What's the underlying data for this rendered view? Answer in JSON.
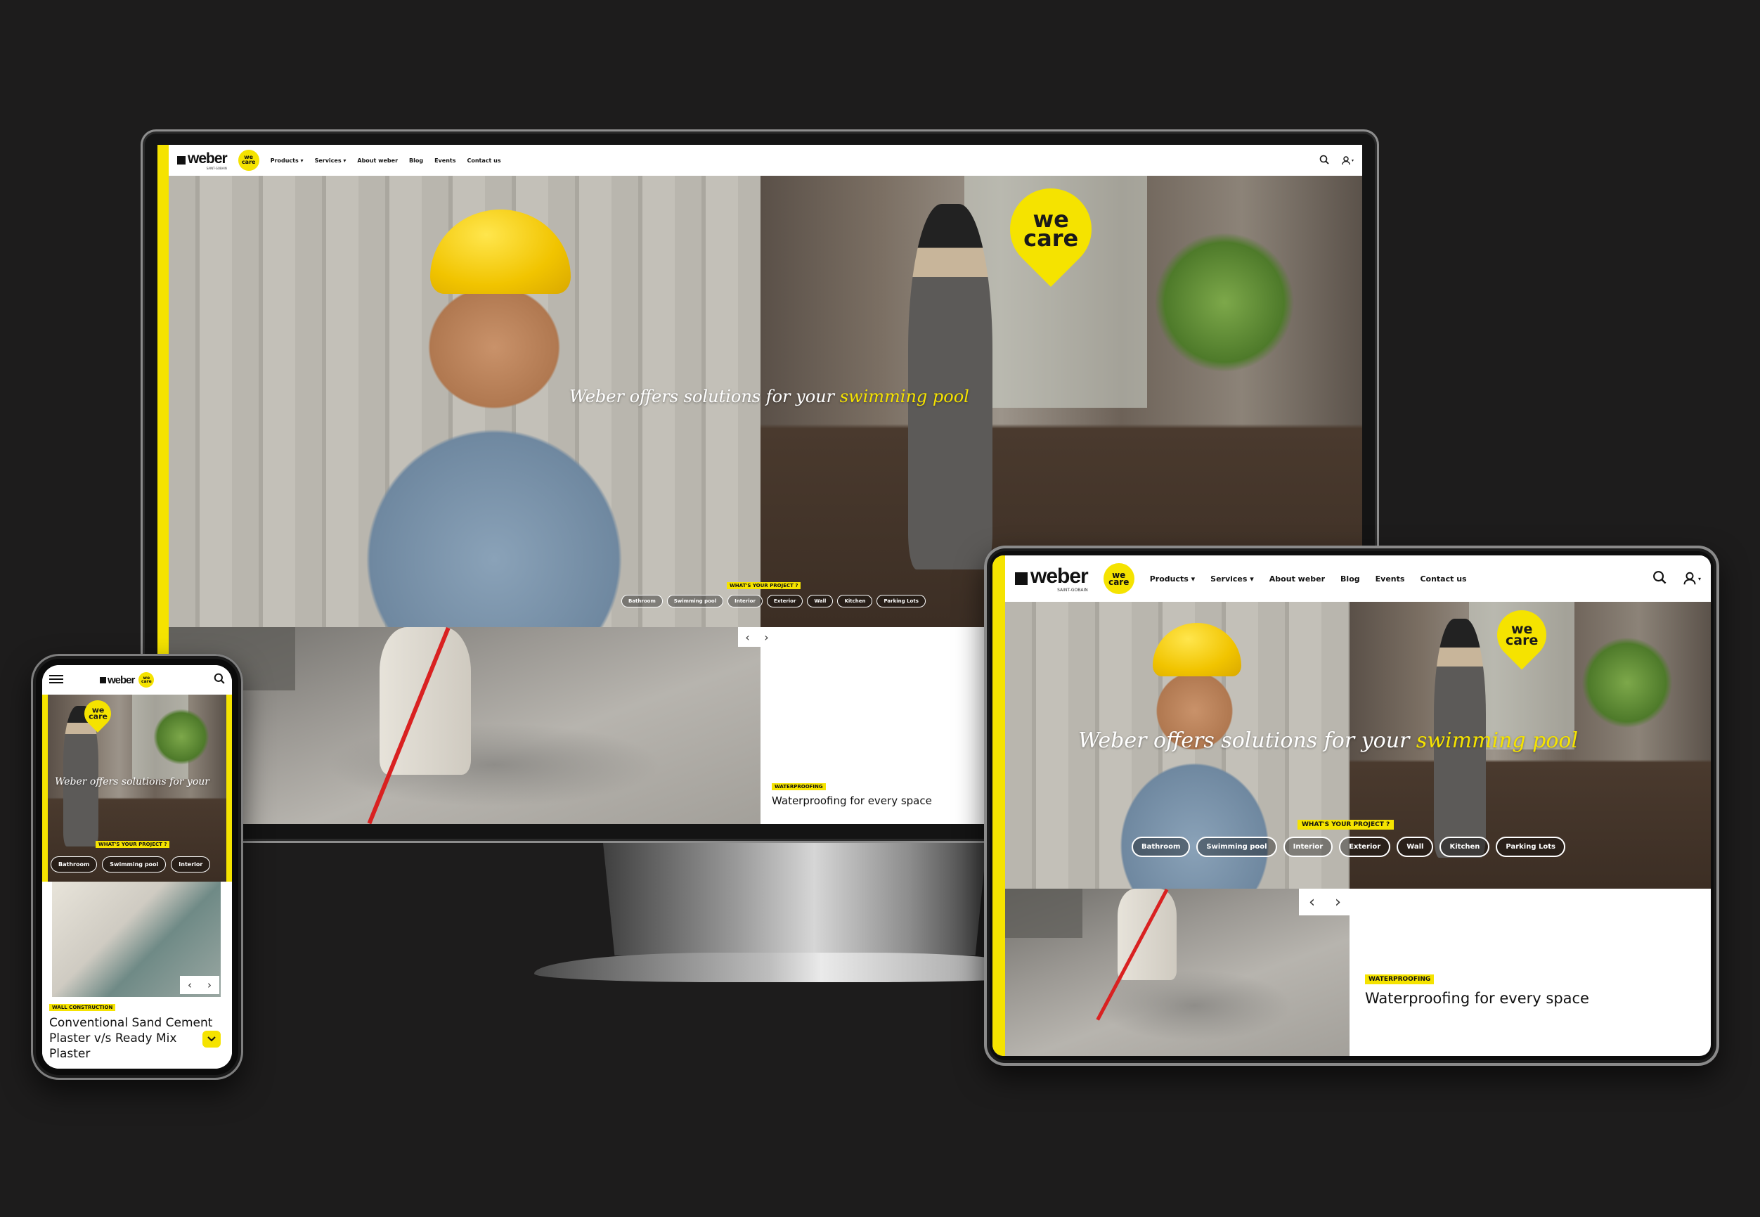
{
  "colors": {
    "background": "#1d1c1c",
    "brand_yellow": "#f5e300",
    "text": "#111111",
    "accent_red": "#d92121"
  },
  "brand": {
    "logo_text": "weber",
    "logo_sub": "SAINT-GOBAIN",
    "badge_line1": "we",
    "badge_line2": "care"
  },
  "nav": {
    "products": "Products ▾",
    "services": "Services ▾",
    "about": "About weber",
    "blog": "Blog",
    "events": "Events",
    "contact": "Contact us",
    "user_menu_caret": "▾"
  },
  "icons": {
    "search": "search-icon",
    "user": "user-icon",
    "menu": "hamburger-menu-icon",
    "prev": "chevron-left-icon",
    "next": "chevron-right-icon",
    "expand": "chevron-down-icon"
  },
  "hero": {
    "title_prefix": "Weber offers solutions for your ",
    "title_highlight": "swimming pool",
    "mobile_title": "Weber offers solutions for your",
    "project_label": "WHAT'S YOUR PROJECT ?",
    "chips": [
      "Bathroom",
      "Swimming pool",
      "Interior",
      "Exterior",
      "Wall",
      "Kitchen",
      "Parking Lots"
    ]
  },
  "slider": {
    "prev": "‹",
    "next": "›",
    "tag": "WATERPROOFING",
    "title": "Waterproofing for every space"
  },
  "mobile_slide": {
    "tag": "WALL CONSTRUCTION",
    "title_line1": "Conventional Sand Cement",
    "title_line2": "Plaster v/s Ready Mix",
    "title_line3": "Plaster"
  }
}
